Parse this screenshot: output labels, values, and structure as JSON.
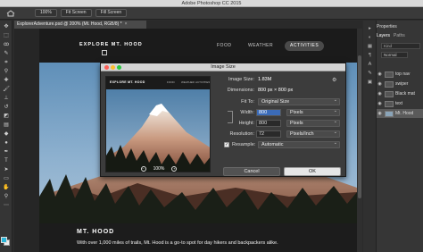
{
  "app": {
    "title": "Adobe Photoshop CC 2015"
  },
  "options_bar": {
    "zoom_value": "100%",
    "fit_screen": "Fit Screen",
    "fill_screen": "Fill Screen"
  },
  "document": {
    "tab_title": "ExplorerAdventure.psd @ 200% (Mt. Hood, RGB/8) *",
    "tab_close": "×"
  },
  "website": {
    "logo": "EXPLORE MT. HOOD",
    "nav": [
      "FOOD",
      "WEATHER",
      "ACTIVITIES"
    ],
    "section_title": "MT. HOOD",
    "section_text": "With over 1,000 miles of trails, Mt. Hood is a go-to spot for day hikers and backpackers alike."
  },
  "dialog": {
    "title": "Image Size",
    "preview_zoom": "100%",
    "image_size_label": "Image Size:",
    "image_size_value": "1.83M",
    "dimensions_label": "Dimensions:",
    "dimensions_value": "800 px × 800 px",
    "fit_to_label": "Fit To:",
    "fit_to_value": "Original Size",
    "width_label": "Width:",
    "width_value": "800",
    "width_unit": "Pixels",
    "height_label": "Height:",
    "height_value": "800",
    "height_unit": "Pixels",
    "resolution_label": "Resolution:",
    "resolution_value": "72",
    "resolution_unit": "Pixels/Inch",
    "resample_label": "Resample:",
    "resample_value": "Automatic",
    "cancel": "Cancel",
    "ok": "OK"
  },
  "panels": {
    "properties": "Properties",
    "tabs": [
      "Layers",
      "Paths"
    ],
    "search": "Kind",
    "blend_mode": "Normal",
    "layers": [
      "top nav",
      "swiper",
      "Black mat",
      "text",
      "Mt. Hood"
    ]
  },
  "colors": {
    "foreground": "#2bb5d8",
    "background": "#eeeeee"
  }
}
